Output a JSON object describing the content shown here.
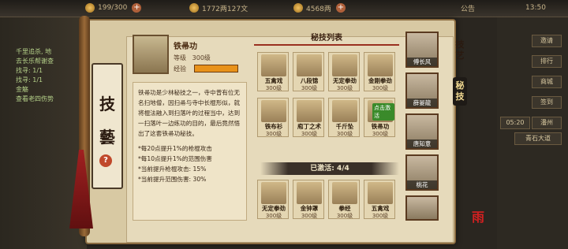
{
  "topbar": {
    "stamina": "199/300",
    "gold": "1772两127文",
    "ingot": "4568两",
    "announce": "公告",
    "time": "13:50"
  },
  "quests": [
    "千里追杀, 地",
    "去长乐帮谢查",
    "找寻: 1/1",
    "找寻: 1/1",
    "金觞",
    "查看老四伤势"
  ],
  "side_buttons": [
    "邀请",
    "排行",
    "商城",
    "签到",
    "潘州",
    "05:20"
  ],
  "side_bottom": "青石大道",
  "panel_title_chars": [
    "技",
    "藝"
  ],
  "skill_detail": {
    "name": "铁帚功",
    "level_label": "等级",
    "level_value": "300级",
    "exp_label": "经验",
    "exp_fraction": 1.0,
    "description": "铁帚功是少林秘技之一，寺中曾有位无名扫地僧，因扫帚与寺中长棍形似，就将棍法融入到扫落叶的过程当中，达到一扫落叶一边练功的目的，最后竟然悟出了这套铁帚功秘技。",
    "bonuses": [
      "*每20点提升1%的枪棍攻击",
      "*每10点提升1%的范围伤害",
      "*当前提升枪棍攻击: 15%",
      "*当前提升范围伤害: 30%"
    ]
  },
  "list_title": "秘技列表",
  "skill_list": [
    {
      "name": "五禽戏",
      "level": "300级"
    },
    {
      "name": "八段锦",
      "level": "300级"
    },
    {
      "name": "无定拳劲",
      "level": "300级"
    },
    {
      "name": "金刚拳劲",
      "level": "300级"
    },
    {
      "name": "铁布衫",
      "level": "300级"
    },
    {
      "name": "庖丁之术",
      "level": "300级"
    },
    {
      "name": "千斤坠",
      "level": "300级"
    },
    {
      "name": "铁帚功",
      "level": "300级",
      "badge": "点击激活"
    }
  ],
  "activated": "已激活: 4/4",
  "activated_list": [
    {
      "name": "无定拳劲",
      "level": "300级"
    },
    {
      "name": "金钟罩",
      "level": "300级"
    },
    {
      "name": "拳经",
      "level": "300级"
    },
    {
      "name": "五禽戏",
      "level": "300级"
    }
  ],
  "characters": [
    "傅长风",
    "薛晏龍",
    "唐知意",
    "桃花",
    ""
  ],
  "tabs": [
    {
      "label": "技艺"
    },
    {
      "label": "秘技"
    }
  ],
  "logo": "雨"
}
